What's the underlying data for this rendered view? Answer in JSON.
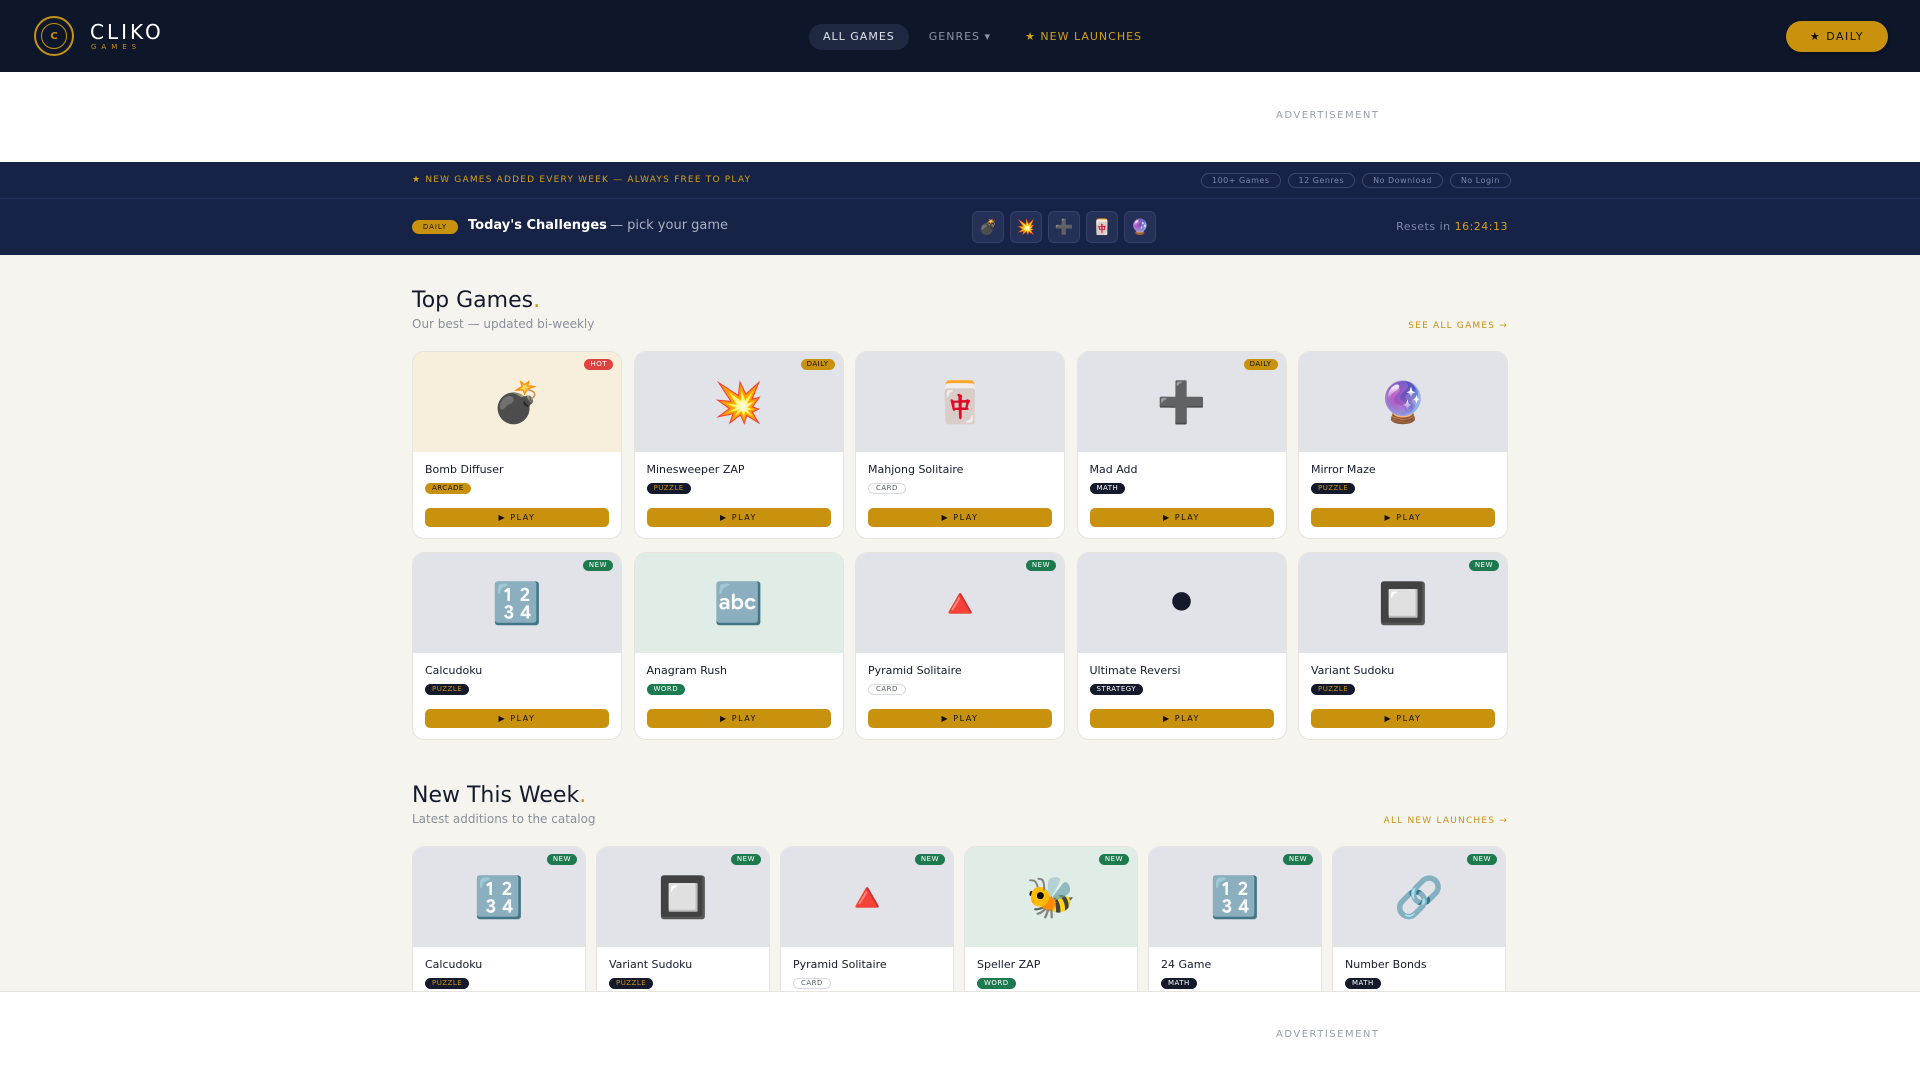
{
  "header": {
    "brand_name": "CLIKO",
    "brand_sub": "GAMES",
    "logo_letter": "C",
    "nav": [
      {
        "label": "ALL GAMES"
      },
      {
        "label": "GENRES ▾"
      },
      {
        "label": "★ NEW LAUNCHES"
      }
    ],
    "daily_button": "★ DAILY"
  },
  "ads": {
    "label": "ADVERTISEMENT"
  },
  "banner": {
    "text": "★  NEW GAMES ADDED EVERY WEEK — ALWAYS FREE TO PLAY",
    "chips": [
      "100+ Games",
      "12 Genres",
      "No Download",
      "No Login"
    ]
  },
  "challenges": {
    "pill": "DAILY",
    "title": "Today's Challenges",
    "subtitle": "— pick your game",
    "icons": [
      "💣",
      "💥",
      "➕",
      "🀄",
      "🔮"
    ],
    "resets_label": "Resets in",
    "resets_time": "16:24:13"
  },
  "top_games": {
    "title": "Top Games",
    "subtitle": "Our best — updated bi-weekly",
    "link": "SEE ALL GAMES →",
    "play_label": "▶ PLAY",
    "cards": [
      {
        "name": "Bomb Diffuser",
        "icon": "💣",
        "tag": "ARCADE",
        "badge": "HOT"
      },
      {
        "name": "Minesweeper ZAP",
        "icon": "💥",
        "tag": "PUZZLE",
        "badge": "DAILY"
      },
      {
        "name": "Mahjong Solitaire",
        "icon": "🀄",
        "tag": "CARD",
        "badge": ""
      },
      {
        "name": "Mad Add",
        "icon": "➕",
        "tag": "MATH",
        "badge": "DAILY"
      },
      {
        "name": "Mirror Maze",
        "icon": "🔮",
        "tag": "PUZZLE",
        "badge": ""
      },
      {
        "name": "Calcudoku",
        "icon": "🔢",
        "tag": "PUZZLE",
        "badge": "NEW"
      },
      {
        "name": "Anagram Rush",
        "icon": "🔤",
        "tag": "WORD",
        "badge": ""
      },
      {
        "name": "Pyramid Solitaire",
        "icon": "🔺",
        "tag": "CARD",
        "badge": "NEW"
      },
      {
        "name": "Ultimate Reversi",
        "icon": "⚫",
        "tag": "STRATEGY",
        "badge": ""
      },
      {
        "name": "Variant Sudoku",
        "icon": "🔲",
        "tag": "PUZZLE",
        "badge": "NEW"
      }
    ]
  },
  "new_this_week": {
    "title": "New This Week",
    "subtitle": "Latest additions to the catalog",
    "link": "ALL NEW LAUNCHES →",
    "cards": [
      {
        "name": "Calcudoku",
        "icon": "🔢",
        "tag": "PUZZLE",
        "badge": "NEW"
      },
      {
        "name": "Variant Sudoku",
        "icon": "🔲",
        "tag": "PUZZLE",
        "badge": "NEW"
      },
      {
        "name": "Pyramid Solitaire",
        "icon": "🔺",
        "tag": "CARD",
        "badge": "NEW"
      },
      {
        "name": "Speller ZAP",
        "icon": "🐝",
        "tag": "WORD",
        "badge": "NEW"
      },
      {
        "name": "24 Game",
        "icon": "🔢",
        "tag": "MATH",
        "badge": "NEW"
      },
      {
        "name": "Number Bonds",
        "icon": "🔗",
        "tag": "MATH",
        "badge": "NEW"
      }
    ]
  },
  "colors": {
    "header_bg": "#0e1629",
    "banner_bg": "#162246",
    "accent_gold": "#c8920f",
    "page_bg": "#f5f4ef",
    "new_green": "#1c7a4e",
    "hot_red": "#e0433d"
  }
}
